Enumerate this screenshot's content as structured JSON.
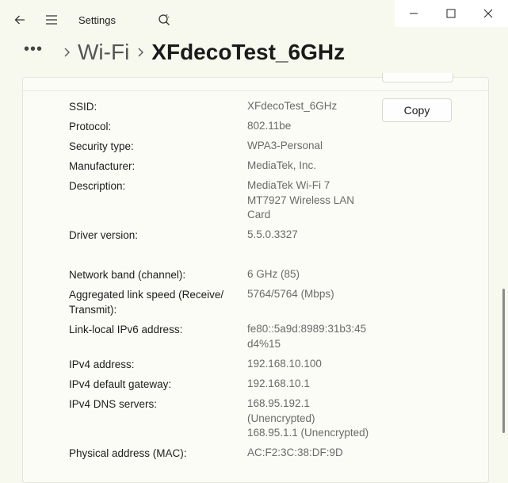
{
  "app": {
    "title": "Settings"
  },
  "breadcrumb": {
    "more": "•••",
    "parent": "Wi-Fi",
    "current": "XFdecoTest_6GHz"
  },
  "copy_label": "Copy",
  "props": [
    {
      "label": "SSID:",
      "value": "XFdecoTest_6GHz"
    },
    {
      "label": "Protocol:",
      "value": "802.11be"
    },
    {
      "label": "Security type:",
      "value": "WPA3-Personal"
    },
    {
      "label": "Manufacturer:",
      "value": "MediaTek, Inc."
    },
    {
      "label": "Description:",
      "value": "MediaTek Wi-Fi 7\nMT7927 Wireless LAN\nCard"
    },
    {
      "label": "Driver version:",
      "value": "5.5.0.3327"
    },
    {
      "label": "Network band (channel):",
      "value": "6 GHz (85)"
    },
    {
      "label": "Aggregated link speed (Receive/\nTransmit):",
      "value": "5764/5764 (Mbps)"
    },
    {
      "label": "Link-local IPv6 address:",
      "value": "fe80::5a9d:8989:31b3:45\nd4%15"
    },
    {
      "label": "IPv4 address:",
      "value": "192.168.10.100"
    },
    {
      "label": "IPv4 default gateway:",
      "value": "192.168.10.1"
    },
    {
      "label": "IPv4 DNS servers:",
      "value": "168.95.192.1\n(Unencrypted)\n168.95.1.1 (Unencrypted)"
    },
    {
      "label": "Physical address (MAC):",
      "value": "AC:F2:3C:38:DF:9D"
    }
  ]
}
